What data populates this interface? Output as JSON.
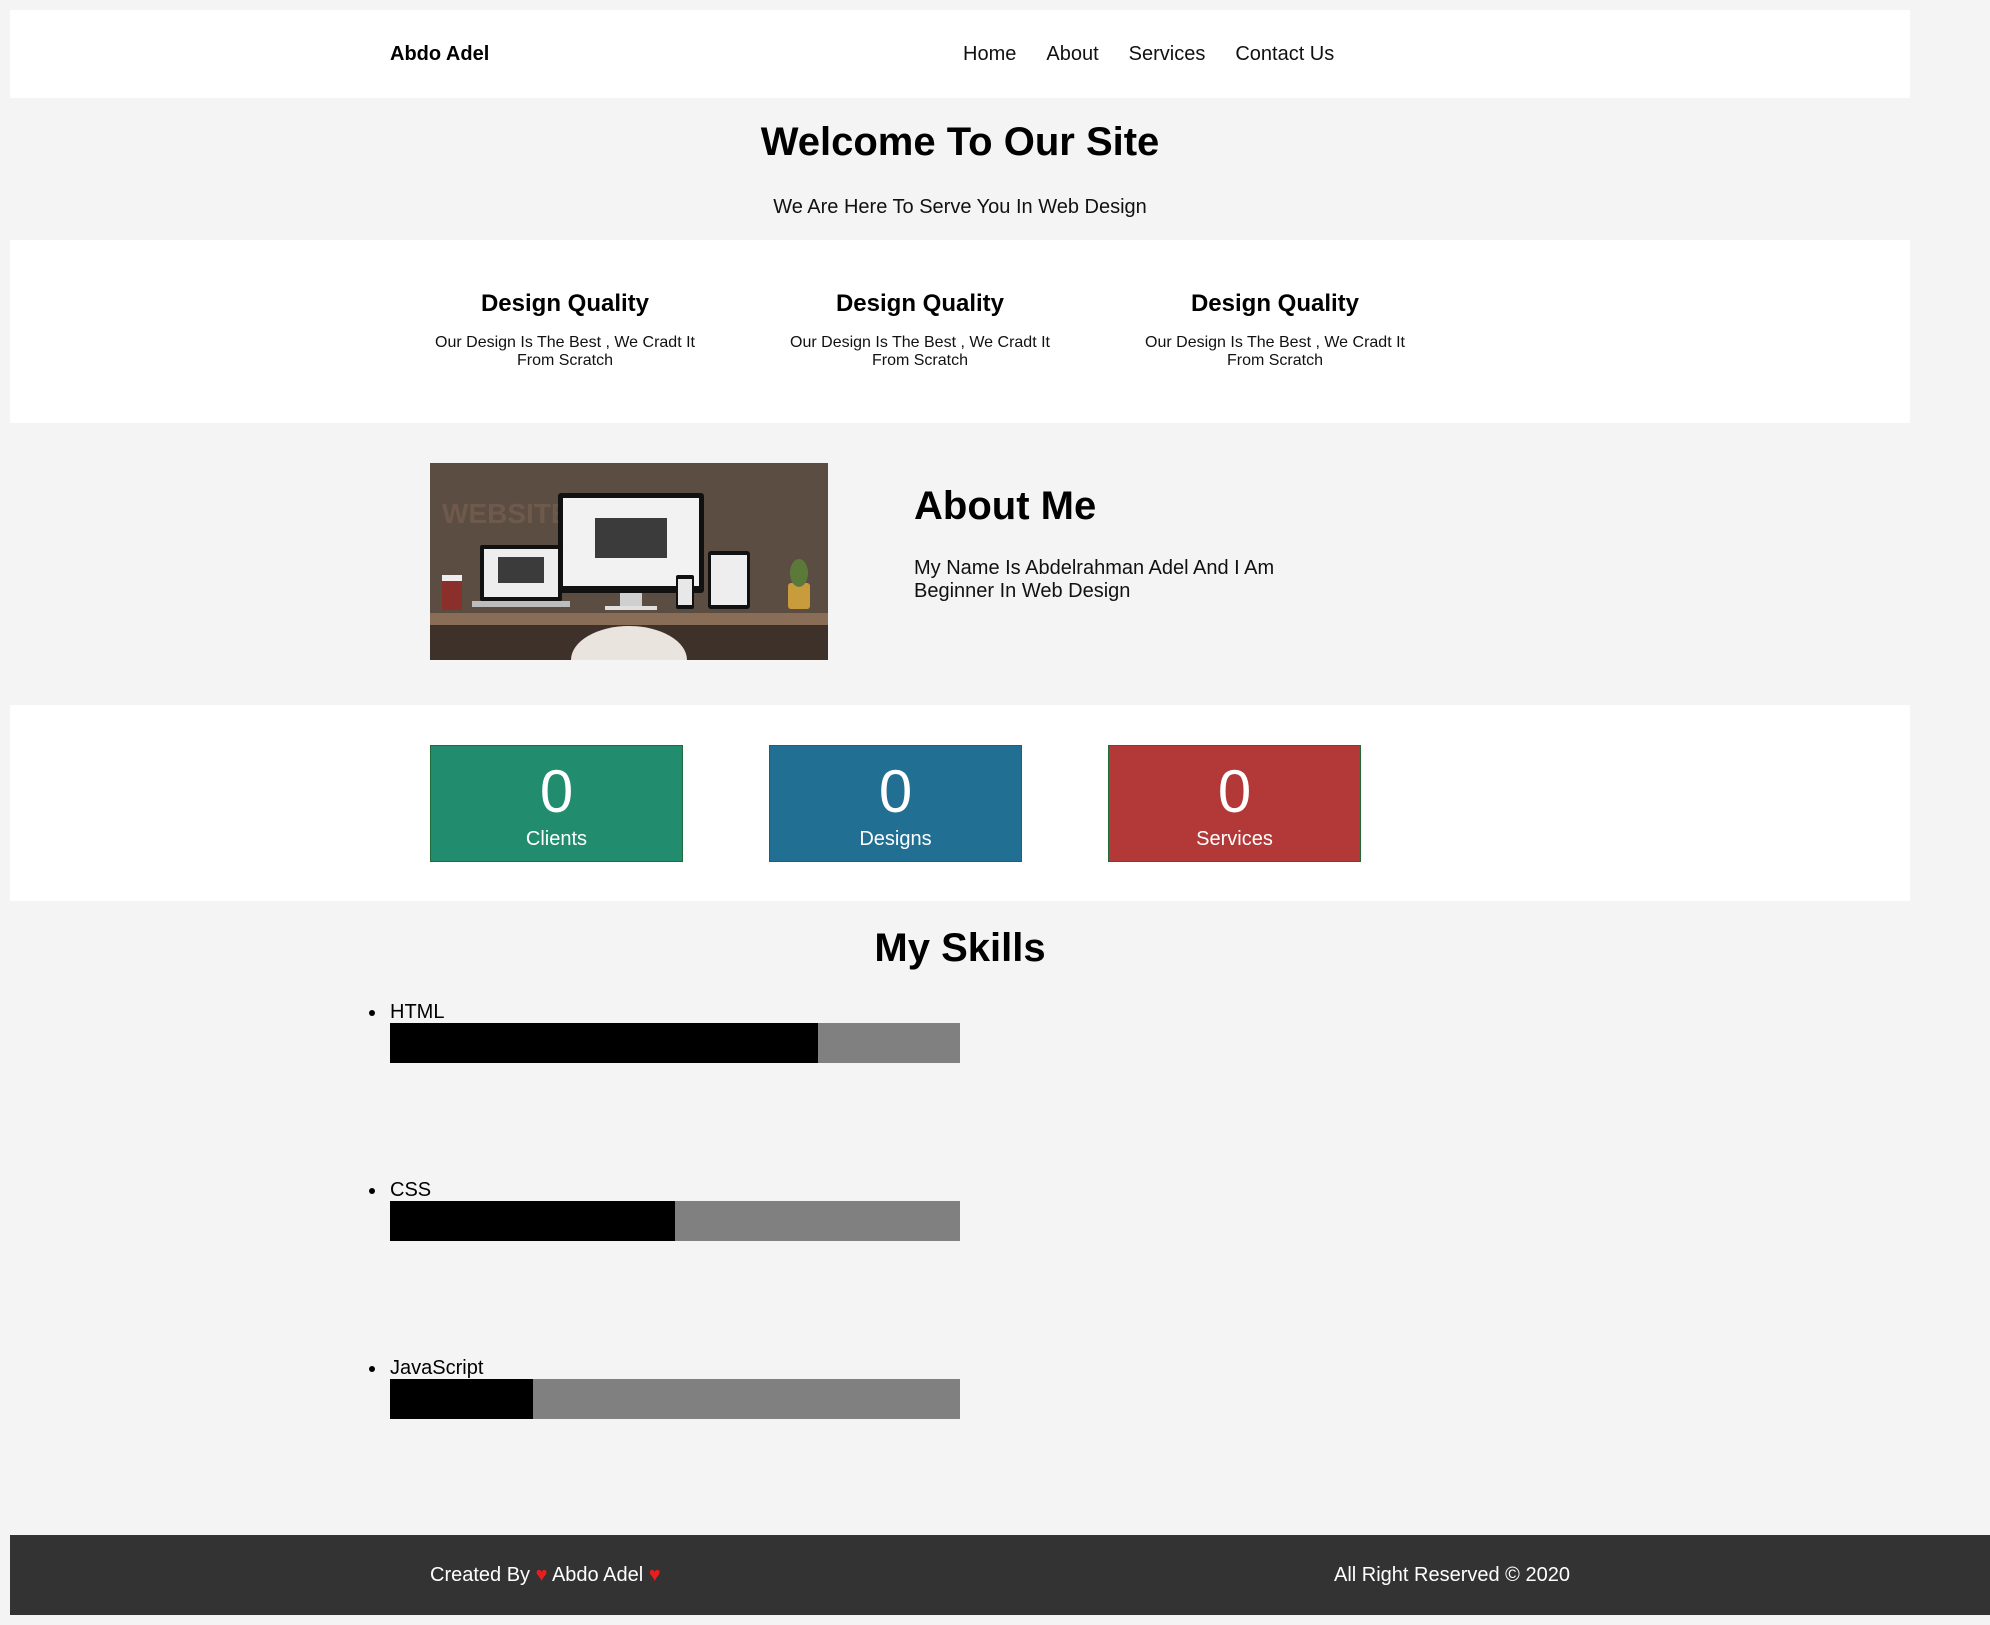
{
  "header": {
    "logo": "Abdo Adel",
    "nav": [
      "Home",
      "About",
      "Services",
      "Contact Us"
    ]
  },
  "hero": {
    "title": "Welcome To Our Site",
    "subtitle": "We Are Here To Serve You In Web Design"
  },
  "features": [
    {
      "title": "Design Quality",
      "text": "Our Design Is The Best , We Cradt It From Scratch"
    },
    {
      "title": "Design Quality",
      "text": "Our Design Is The Best , We Cradt It From Scratch"
    },
    {
      "title": "Design Quality",
      "text": "Our Design Is The Best , We Cradt It From Scratch"
    }
  ],
  "about": {
    "image_text": "WEBSITE",
    "title": "About Me",
    "text": "My Name Is Abdelrahman Adel And I Am Beginner In Web Design"
  },
  "stats": [
    {
      "value": "0",
      "label": "Clients",
      "color": "#218d6e"
    },
    {
      "value": "0",
      "label": "Designs",
      "color": "#226f94"
    },
    {
      "value": "0",
      "label": "Services",
      "color": "#b33838"
    }
  ],
  "skills": {
    "title": "My Skills",
    "items": [
      {
        "name": "HTML",
        "progress": 0.75
      },
      {
        "name": "CSS",
        "progress": 0.5
      },
      {
        "name": "JavaScript",
        "progress": 0.25
      }
    ]
  },
  "footer": {
    "created_by": "Created By",
    "heart": "♥",
    "author": "Abdo Adel",
    "rights": "All Right Reserved © 2020"
  },
  "colors": {
    "page_bg": "#f4f4f4",
    "footer_bg": "#333333",
    "bar_fill": "#000000",
    "bar_track": "#808080",
    "heart": "#e81e1e"
  }
}
